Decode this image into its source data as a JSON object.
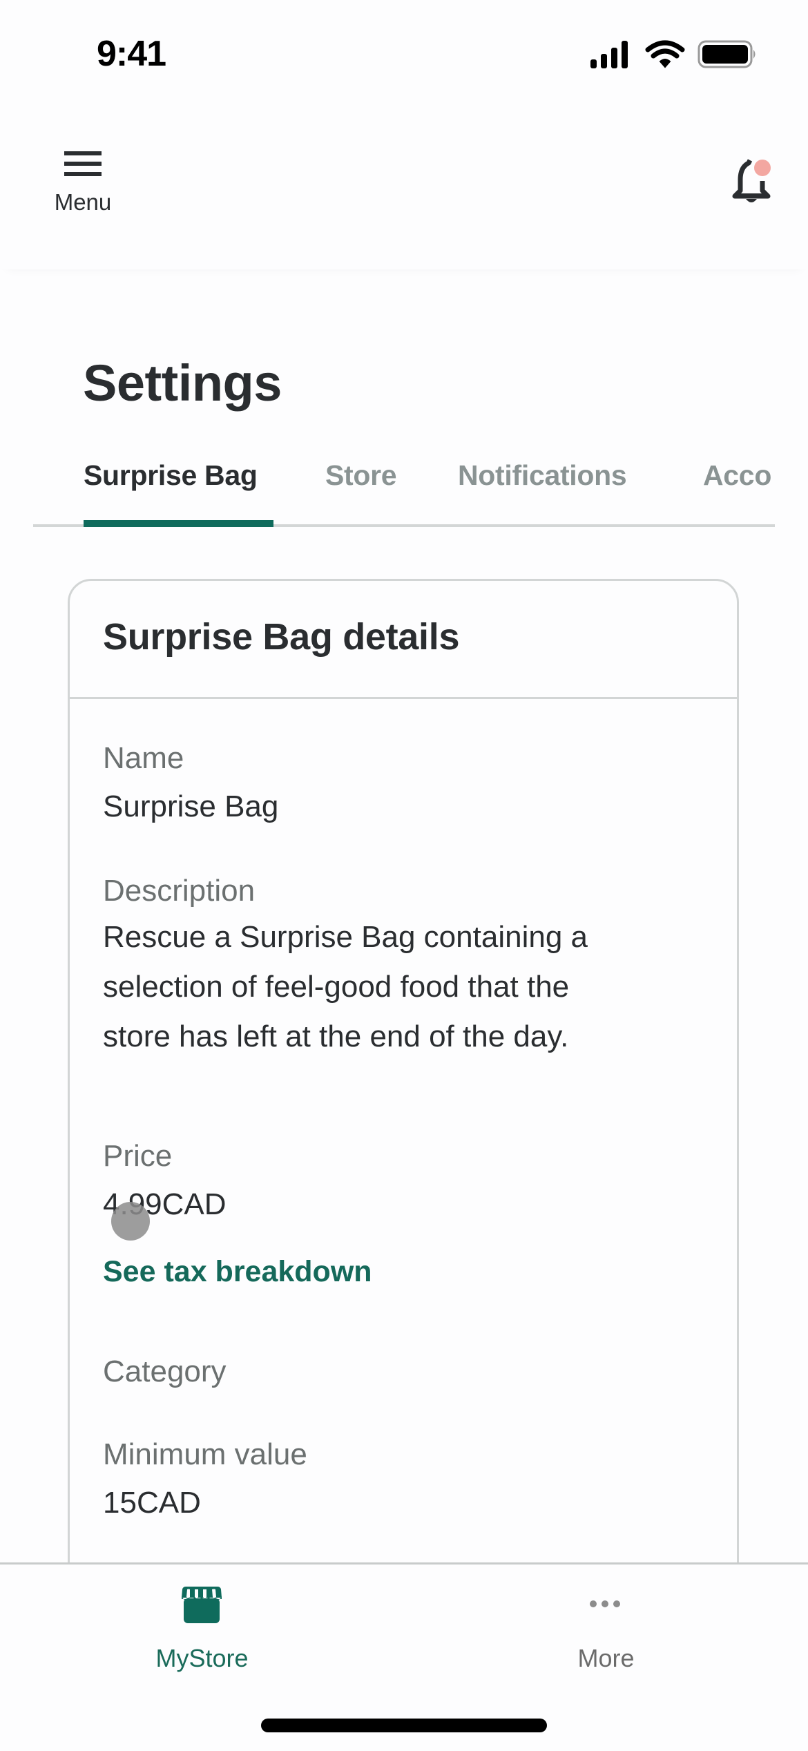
{
  "status_bar": {
    "time": "9:41",
    "icons": [
      "cellular-signal-icon",
      "wifi-icon",
      "battery-icon"
    ]
  },
  "header": {
    "menu_label": "Menu",
    "menu_icon": "hamburger-menu-icon",
    "notifications_icon": "bell-icon",
    "has_unread_notifications": true
  },
  "page": {
    "title": "Settings"
  },
  "tabs": [
    {
      "label": "Surprise Bag",
      "active": true
    },
    {
      "label": "Store",
      "active": false
    },
    {
      "label": "Notifications",
      "active": false
    },
    {
      "label": "Acco",
      "active": false
    }
  ],
  "card": {
    "title": "Surprise Bag details",
    "fields": {
      "name": {
        "label": "Name",
        "value": "Surprise Bag"
      },
      "description": {
        "label": "Description",
        "value": "Rescue a Surprise Bag containing a selection of feel-good food that the store has left at the end of the day."
      },
      "price": {
        "label": "Price",
        "value": "4.99CAD",
        "link": "See tax breakdown"
      },
      "category": {
        "label": "Category",
        "value": ""
      },
      "minimum_value": {
        "label": "Minimum value",
        "value": "15CAD"
      }
    }
  },
  "bottom_nav": {
    "items": [
      {
        "label": "MyStore",
        "icon": "storefront-icon",
        "active": true
      },
      {
        "label": "More",
        "icon": "more-dots-icon",
        "active": false
      }
    ]
  },
  "colors": {
    "brand_green": "#0f6b5c",
    "text_primary": "#2a2d30",
    "text_secondary": "#6b7070",
    "tab_inactive": "#8a9393",
    "notification_dot": "#f3a7a1"
  }
}
